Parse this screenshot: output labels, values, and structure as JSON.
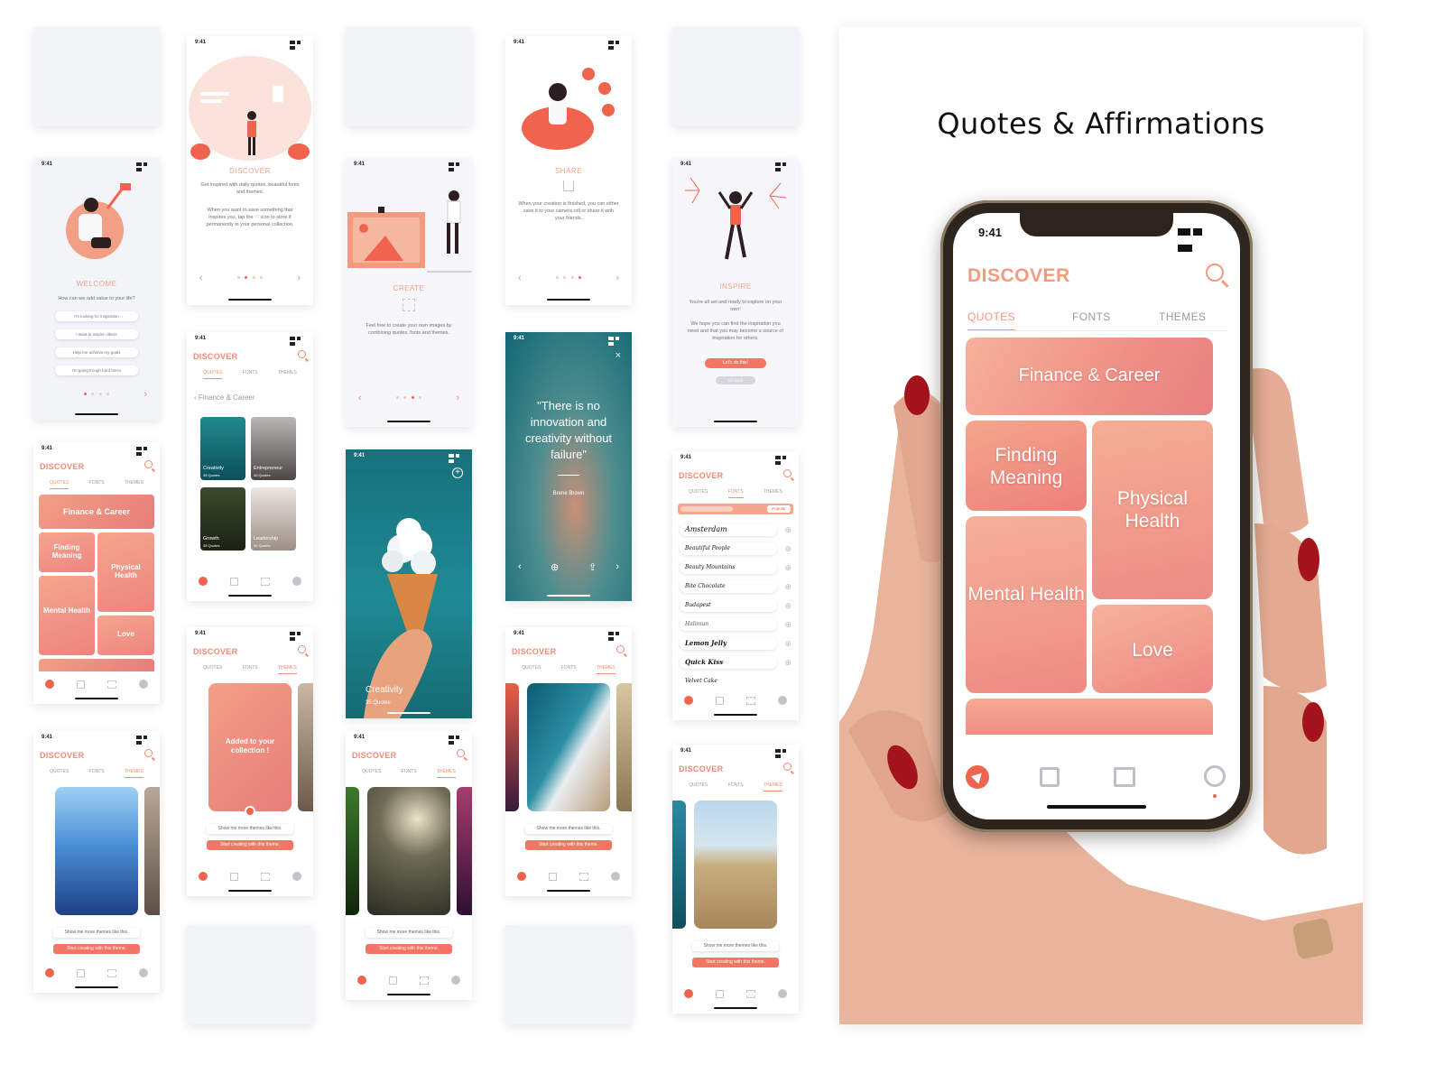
{
  "big": {
    "title": "Quotes & Affirmations",
    "phone": {
      "time": "9:41",
      "header": "DISCOVER",
      "tabs": [
        "QUOTES",
        "FONTS",
        "THEMES"
      ],
      "tiles": [
        "Finance & Career",
        "Finding Meaning",
        "Physical Health",
        "Mental Health",
        "Love"
      ]
    }
  },
  "screens": {
    "time": "9:41",
    "welcome": {
      "title": "WELCOME",
      "question": "How can we add value to your life?",
      "options": [
        "I'm looking for inspiration",
        "I want to inspire others",
        "Help me achieve my goals",
        "I'm going trough hard times"
      ]
    },
    "discover_ob": {
      "title": "DISCOVER",
      "text1": "Get inspired with daily quotes, beautiful fonts and themes.",
      "text2": "When you want to save something that inspires you, tap the  ♡  icon to store it permanently in your personal collection."
    },
    "create_ob": {
      "title": "CREATE",
      "text": "Feel free to create your own images by combining quotes, fonts and themes."
    },
    "share_ob": {
      "title": "SHARE",
      "text": "When your creation is finished, you can either save it to your camera roll or share it with your friends."
    },
    "inspire_ob": {
      "title": "INSPIRE",
      "text1": "You're all set and ready to explore on your own!",
      "text2": "We hope you can find the inspiration you need and that you may become a source of inspiration for others.",
      "cta": "Let's do this!",
      "back": "Go back"
    },
    "discover": "DISCOVER",
    "tabs": [
      "QUOTES",
      "FONTS",
      "THEMES"
    ],
    "category_back": "Finance & Career",
    "categories": [
      {
        "name": "Creativity",
        "count": "35 Quotes"
      },
      {
        "name": "Entrepreneur",
        "count": "40 Quotes"
      },
      {
        "name": "Growth",
        "count": "45 Quotes"
      },
      {
        "name": "Leadership",
        "count": "50 Quotes"
      }
    ],
    "mini_tiles": [
      "Finance & Career",
      "Finding Meaning",
      "Physical Health",
      "Mental Health",
      "Love"
    ],
    "quote": {
      "text": "\"There is no innovation and creativity without failure\"",
      "author": "Brene Brown"
    },
    "creativity": {
      "name": "Creativity",
      "count": "35 Quotes"
    },
    "fonts": [
      "Amsterdam",
      "Beautiful People",
      "Beauty Mountains",
      "Bite Chocolate",
      "Budapest",
      "Halimun",
      "Lemon Jelly",
      "Quick Kiss",
      "Velvet Cake"
    ],
    "font_filter": "Popular",
    "added": "Added to your collection !",
    "more_themes": "Show me more themes like this.",
    "start_creating": "Start creating with this theme."
  },
  "colors": {
    "accent": "#f28b74",
    "accent_strong": "#f0644f",
    "teal": "#1d7c84",
    "bg_card": "#f3f4f8"
  }
}
